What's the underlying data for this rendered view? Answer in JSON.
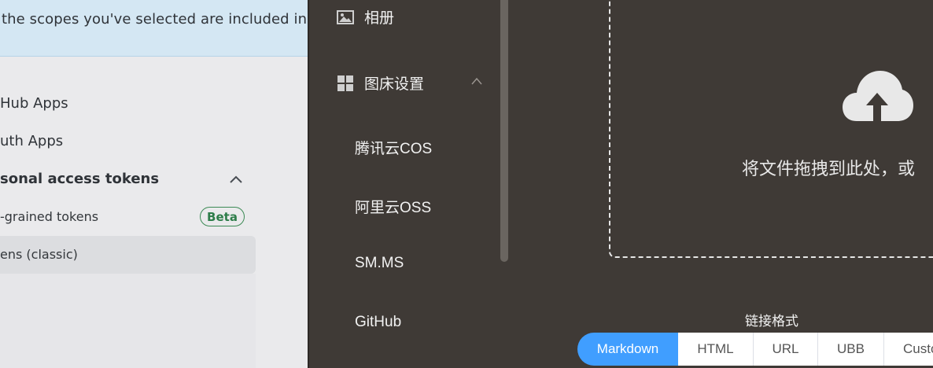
{
  "github": {
    "banner_text": "the scopes you've selected are included in",
    "nav": {
      "github_apps": "Hub Apps",
      "oauth_apps": "uth Apps",
      "personal_access_tokens": "sonal access tokens",
      "fine_grained": "-grained tokens",
      "beta_badge": "Beta",
      "classic": "ens (classic)"
    }
  },
  "sidebar": {
    "album": "相册",
    "image_host_settings": "图床设置",
    "items": [
      "腾讯云COS",
      "阿里云OSS",
      "SM.MS",
      "GitHub"
    ]
  },
  "upload": {
    "drop_text": "将文件拖拽到此处，或",
    "format_label": "链接格式",
    "formats": [
      "Markdown",
      "HTML",
      "URL",
      "UBB",
      "Custo"
    ],
    "active_format": "Markdown"
  },
  "colors": {
    "accent": "#409eff",
    "dark_bg": "#3f3a36",
    "banner_bg": "#d4e7f3",
    "beta_green": "#2e7d4a"
  },
  "icons": [
    "image-icon",
    "grid-icon",
    "chevron-up-icon",
    "cloud-upload-icon"
  ]
}
